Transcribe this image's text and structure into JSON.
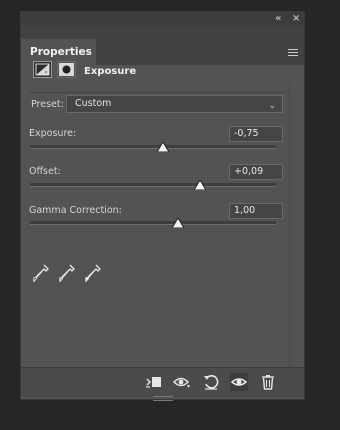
{
  "panel": {
    "tab_label": "Properties",
    "adjustment_title": "Exposure"
  },
  "preset": {
    "label": "Preset:",
    "value": "Custom"
  },
  "sliders": [
    {
      "label": "Exposure:",
      "value": "-0,75",
      "level": 0.54
    },
    {
      "label": "Offset:",
      "value": "+0,09",
      "level": 0.69
    },
    {
      "label": "Gamma Correction:",
      "value": "1,00",
      "level": 0.6
    }
  ],
  "icons": {
    "titlebar": [
      "collapse-icon",
      "close-icon"
    ],
    "tools": [
      "black-point-eyedropper-icon",
      "gray-point-eyedropper-icon",
      "white-point-eyedropper-icon"
    ],
    "footer": [
      "clip-to-layer-icon",
      "view-previous-state-icon",
      "reset-icon",
      "toggle-visibility-icon",
      "delete-icon"
    ]
  },
  "colors": {
    "panel_bg": "#535353",
    "field_bg": "#454545",
    "app_bg": "#262626"
  }
}
